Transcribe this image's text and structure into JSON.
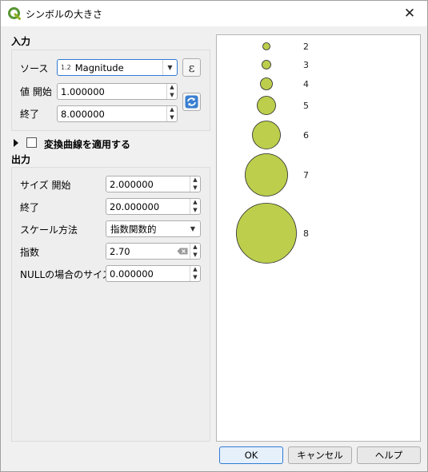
{
  "window": {
    "title": "シンボルの大きさ",
    "close_glyph": "✕"
  },
  "input": {
    "section_label": "入力",
    "source_label": "ソース",
    "source_type_prefix": "1.2",
    "source_value": "Magnitude",
    "value_start_label": "値 開始",
    "value_start": "1.000000",
    "value_end_label": "終了",
    "value_end": "8.000000"
  },
  "curve": {
    "label": "変換曲線を適用する",
    "checked": false
  },
  "output": {
    "section_label": "出力",
    "size_start_label": "サイズ 開始",
    "size_start": "2.000000",
    "size_end_label": "終了",
    "size_end": "20.000000",
    "scale_method_label": "スケール方法",
    "scale_method": "指数関数的",
    "exponent_label": "指数",
    "exponent": "2.70",
    "null_size_label": "NULLの場合のサイズ",
    "null_size": "0.000000"
  },
  "legend": {
    "symbol_color": "#bcce4c",
    "symbol_stroke": "#222222",
    "items": [
      {
        "label": "2"
      },
      {
        "label": "3"
      },
      {
        "label": "4"
      },
      {
        "label": "5"
      },
      {
        "label": "6"
      },
      {
        "label": "7"
      },
      {
        "label": "8"
      }
    ]
  },
  "buttons": {
    "ok": "OK",
    "cancel": "キャンセル",
    "help": "ヘルプ"
  }
}
